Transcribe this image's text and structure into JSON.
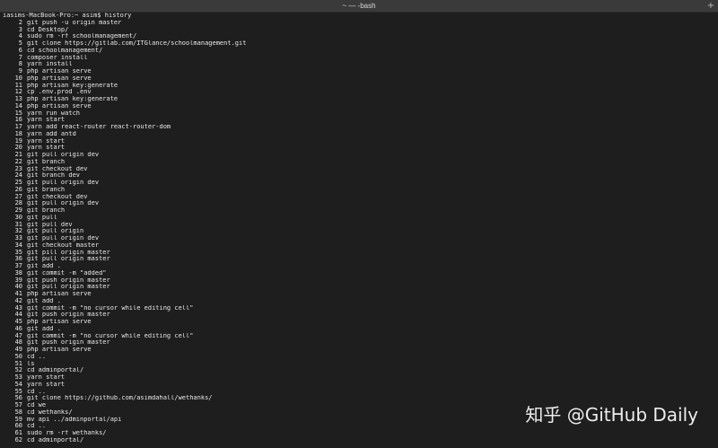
{
  "window": {
    "title": "~ — -bash",
    "new_tab_glyph": "+"
  },
  "terminal": {
    "prompt": "iasims-MacBook-Pro:~ asim$ history",
    "history": [
      {
        "n": "2",
        "cmd": "git push -u origin master"
      },
      {
        "n": "3",
        "cmd": "cd Desktop/"
      },
      {
        "n": "4",
        "cmd": "sudo rm -rf schoolmanagement/"
      },
      {
        "n": "5",
        "cmd": "git clone https://gitlab.com/ITGlance/schoolmanagement.git"
      },
      {
        "n": "6",
        "cmd": "cd schoolmanagement/"
      },
      {
        "n": "7",
        "cmd": "composer install"
      },
      {
        "n": "8",
        "cmd": "yarn install"
      },
      {
        "n": "9",
        "cmd": "php artisan serve"
      },
      {
        "n": "10",
        "cmd": "php artisan serve"
      },
      {
        "n": "11",
        "cmd": "php artisan key:generate"
      },
      {
        "n": "12",
        "cmd": "cp .env.prod .env"
      },
      {
        "n": "13",
        "cmd": "php artisan key:generate"
      },
      {
        "n": "14",
        "cmd": "php artisan serve"
      },
      {
        "n": "15",
        "cmd": "yarn run watch"
      },
      {
        "n": "16",
        "cmd": "yarn start"
      },
      {
        "n": "17",
        "cmd": "yarn add react-router react-router-dom"
      },
      {
        "n": "18",
        "cmd": "yarn add antd"
      },
      {
        "n": "19",
        "cmd": "yarn start"
      },
      {
        "n": "20",
        "cmd": "yarn start"
      },
      {
        "n": "21",
        "cmd": "git pull origin dev"
      },
      {
        "n": "22",
        "cmd": "git branch"
      },
      {
        "n": "23",
        "cmd": "git checkout dev"
      },
      {
        "n": "24",
        "cmd": "git branch dev"
      },
      {
        "n": "25",
        "cmd": "git pull origin dev"
      },
      {
        "n": "26",
        "cmd": "git branch"
      },
      {
        "n": "27",
        "cmd": "git checkout dev"
      },
      {
        "n": "28",
        "cmd": "git pull origin dev"
      },
      {
        "n": "29",
        "cmd": "git branch"
      },
      {
        "n": "30",
        "cmd": "git pull"
      },
      {
        "n": "31",
        "cmd": "git pull dev"
      },
      {
        "n": "32",
        "cmd": "git pull origin"
      },
      {
        "n": "33",
        "cmd": "git pull origin dev"
      },
      {
        "n": "34",
        "cmd": "git checkout master"
      },
      {
        "n": "35",
        "cmd": "git pill origin master"
      },
      {
        "n": "36",
        "cmd": "git pull origin master"
      },
      {
        "n": "37",
        "cmd": "git add ."
      },
      {
        "n": "38",
        "cmd": "git commit -m \"added\""
      },
      {
        "n": "39",
        "cmd": "git push origin master"
      },
      {
        "n": "40",
        "cmd": "git pull origin master"
      },
      {
        "n": "41",
        "cmd": "php artisan serve"
      },
      {
        "n": "42",
        "cmd": "git add ."
      },
      {
        "n": "43",
        "cmd": "git commit -m \"no cursor while editing cell\""
      },
      {
        "n": "44",
        "cmd": "git push origin master"
      },
      {
        "n": "45",
        "cmd": "php artisan serve"
      },
      {
        "n": "46",
        "cmd": "git add ."
      },
      {
        "n": "47",
        "cmd": "git commit -m \"no cursor while editing cell\""
      },
      {
        "n": "48",
        "cmd": "git push origin master"
      },
      {
        "n": "49",
        "cmd": "php artisan serve"
      },
      {
        "n": "50",
        "cmd": "cd .."
      },
      {
        "n": "51",
        "cmd": "ls"
      },
      {
        "n": "52",
        "cmd": "cd adminportal/"
      },
      {
        "n": "53",
        "cmd": "yarn start"
      },
      {
        "n": "54",
        "cmd": "yarn start"
      },
      {
        "n": "55",
        "cmd": "cd .."
      },
      {
        "n": "56",
        "cmd": "git clone https://github.com/asimdahall/wethanks/"
      },
      {
        "n": "57",
        "cmd": "cd we"
      },
      {
        "n": "58",
        "cmd": "cd wethanks/"
      },
      {
        "n": "59",
        "cmd": "mv api ../adminportal/api"
      },
      {
        "n": "60",
        "cmd": "cd .."
      },
      {
        "n": "61",
        "cmd": "sudo rm -rf wethanks/"
      },
      {
        "n": "62",
        "cmd": "cd adminportal/"
      }
    ]
  },
  "watermark": {
    "text": "知乎 @GitHub Daily"
  },
  "colors": {
    "background": "#1e1e1e",
    "titlebar": "#3a3a3a",
    "text": "#e8e8e8"
  }
}
